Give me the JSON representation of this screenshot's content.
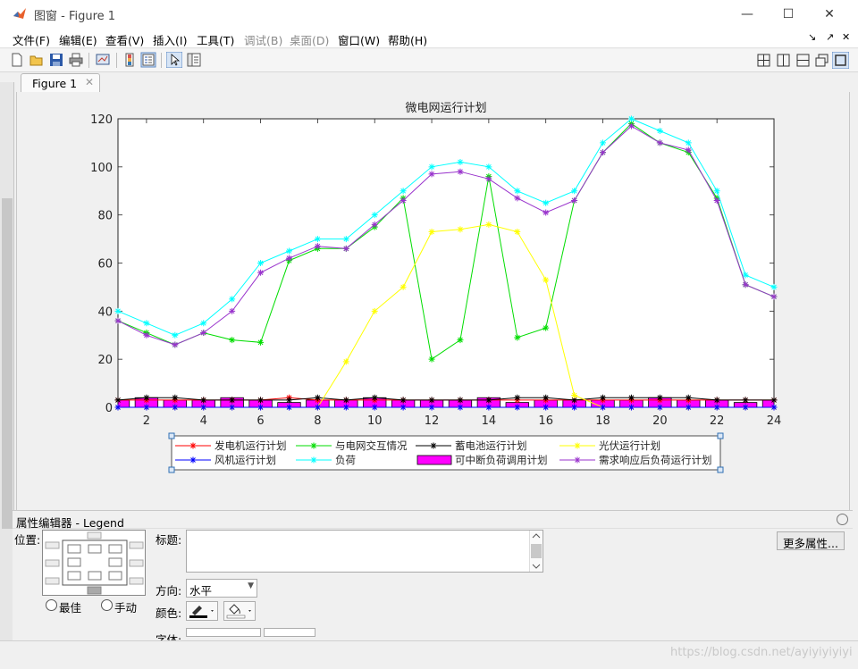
{
  "window": {
    "title": "图窗 - Figure 1",
    "controls": [
      "—",
      "☐",
      "✕"
    ]
  },
  "menu": {
    "items": [
      {
        "label": "文件(F)",
        "enabled": true
      },
      {
        "label": "编辑(E)",
        "enabled": true
      },
      {
        "label": "查看(V)",
        "enabled": true
      },
      {
        "label": "插入(I)",
        "enabled": true
      },
      {
        "label": "工具(T)",
        "enabled": true
      },
      {
        "label": "调试(B)",
        "enabled": false
      },
      {
        "label": "桌面(D)",
        "enabled": false
      },
      {
        "label": "窗口(W)",
        "enabled": true
      },
      {
        "label": "帮助(H)",
        "enabled": true
      }
    ],
    "right_controls": [
      "↘",
      "↗",
      "✕"
    ]
  },
  "toolbar": {
    "buttons": [
      "new-figure-icon",
      "open-folder-icon",
      "save-icon",
      "print-icon",
      "link-plot-icon",
      "colorbar-icon",
      "legend-icon",
      "pointer-icon",
      "property-inspector-icon"
    ],
    "layout_buttons": [
      "tile-grid-icon",
      "split-vertical-icon",
      "split-horizontal-icon",
      "float-icon",
      "dock-single-icon"
    ]
  },
  "tabs": [
    {
      "label": "Figure 1",
      "close": "✕"
    }
  ],
  "chart_data": {
    "type": "line",
    "title": "微电网运行计划",
    "xlabel": "",
    "ylabel": "",
    "xlim": [
      1,
      24
    ],
    "ylim": [
      0,
      120
    ],
    "xticks": [
      2,
      4,
      6,
      8,
      10,
      12,
      14,
      16,
      18,
      20,
      22,
      24
    ],
    "yticks": [
      0,
      20,
      40,
      60,
      80,
      100,
      120
    ],
    "x": [
      1,
      2,
      3,
      4,
      5,
      6,
      7,
      8,
      9,
      10,
      11,
      12,
      13,
      14,
      15,
      16,
      17,
      18,
      19,
      20,
      21,
      22,
      23,
      24
    ],
    "legend_position": "bottom",
    "series": [
      {
        "name": "发电机运行计划",
        "color": "#ff0000",
        "kind": "line",
        "values": [
          3,
          3,
          3,
          3,
          3,
          3,
          4,
          3,
          3,
          3,
          3,
          3,
          3,
          3,
          3,
          3,
          3,
          3,
          3,
          3,
          3,
          3,
          3,
          3
        ]
      },
      {
        "name": "与电网交互情况",
        "color": "#00dd00",
        "kind": "line",
        "values": [
          36,
          31,
          26,
          31,
          28,
          27,
          61,
          66,
          66,
          75,
          87,
          20,
          28,
          96,
          29,
          33,
          86,
          106,
          118,
          110,
          106,
          87,
          51,
          46
        ]
      },
      {
        "name": "蓄电池运行计划",
        "color": "#000000",
        "kind": "line",
        "values": [
          3,
          4,
          4,
          3,
          3,
          3,
          3,
          4,
          3,
          4,
          3,
          3,
          3,
          3,
          4,
          4,
          3,
          4,
          4,
          4,
          4,
          3,
          3,
          3
        ]
      },
      {
        "name": "光伏运行计划",
        "color": "#ffff00",
        "kind": "line",
        "values": [
          0,
          0,
          0,
          0,
          0,
          0,
          0,
          0,
          19,
          40,
          50,
          73,
          74,
          76,
          73,
          53,
          5,
          0,
          0,
          0,
          0,
          0,
          0,
          0
        ]
      },
      {
        "name": "风机运行计划",
        "color": "#0000ff",
        "kind": "line",
        "values": [
          0,
          0,
          0,
          0,
          0,
          0,
          0,
          0,
          0,
          0,
          0,
          0,
          0,
          0,
          0,
          0,
          0,
          0,
          0,
          0,
          0,
          0,
          0,
          0
        ]
      },
      {
        "name": "负荷",
        "color": "#00ffff",
        "kind": "line",
        "values": [
          40,
          35,
          30,
          35,
          45,
          60,
          65,
          70,
          70,
          80,
          90,
          100,
          102,
          100,
          90,
          85,
          90,
          110,
          120,
          115,
          110,
          90,
          55,
          50
        ]
      },
      {
        "name": "可中断负荷调用计划",
        "color": "#ff00ff",
        "kind": "bar",
        "values": [
          3,
          4,
          3,
          3,
          4,
          3,
          2,
          3,
          3,
          4,
          3,
          3,
          3,
          4,
          2,
          3,
          3,
          3,
          3,
          4,
          3,
          3,
          2,
          3
        ]
      },
      {
        "name": "需求响应后负荷运行计划",
        "color": "#9933cc",
        "kind": "line",
        "values": [
          36,
          30,
          26,
          31,
          40,
          56,
          62,
          67,
          66,
          76,
          86,
          97,
          98,
          95,
          87,
          81,
          86,
          106,
          117,
          110,
          107,
          86,
          51,
          46
        ]
      }
    ]
  },
  "property_editor": {
    "header": "属性编辑器 - Legend",
    "position_label": "位置:",
    "title_label": "标题:",
    "title_value": "",
    "orientation_label": "方向:",
    "orientation_value": "水平",
    "color_label": "颜色:",
    "font_label": "字体:",
    "radio_best": "最佳",
    "radio_manual": "手动",
    "more_button": "更多属性..."
  },
  "watermark": "https://blog.csdn.net/ayiyiyiyiyi"
}
